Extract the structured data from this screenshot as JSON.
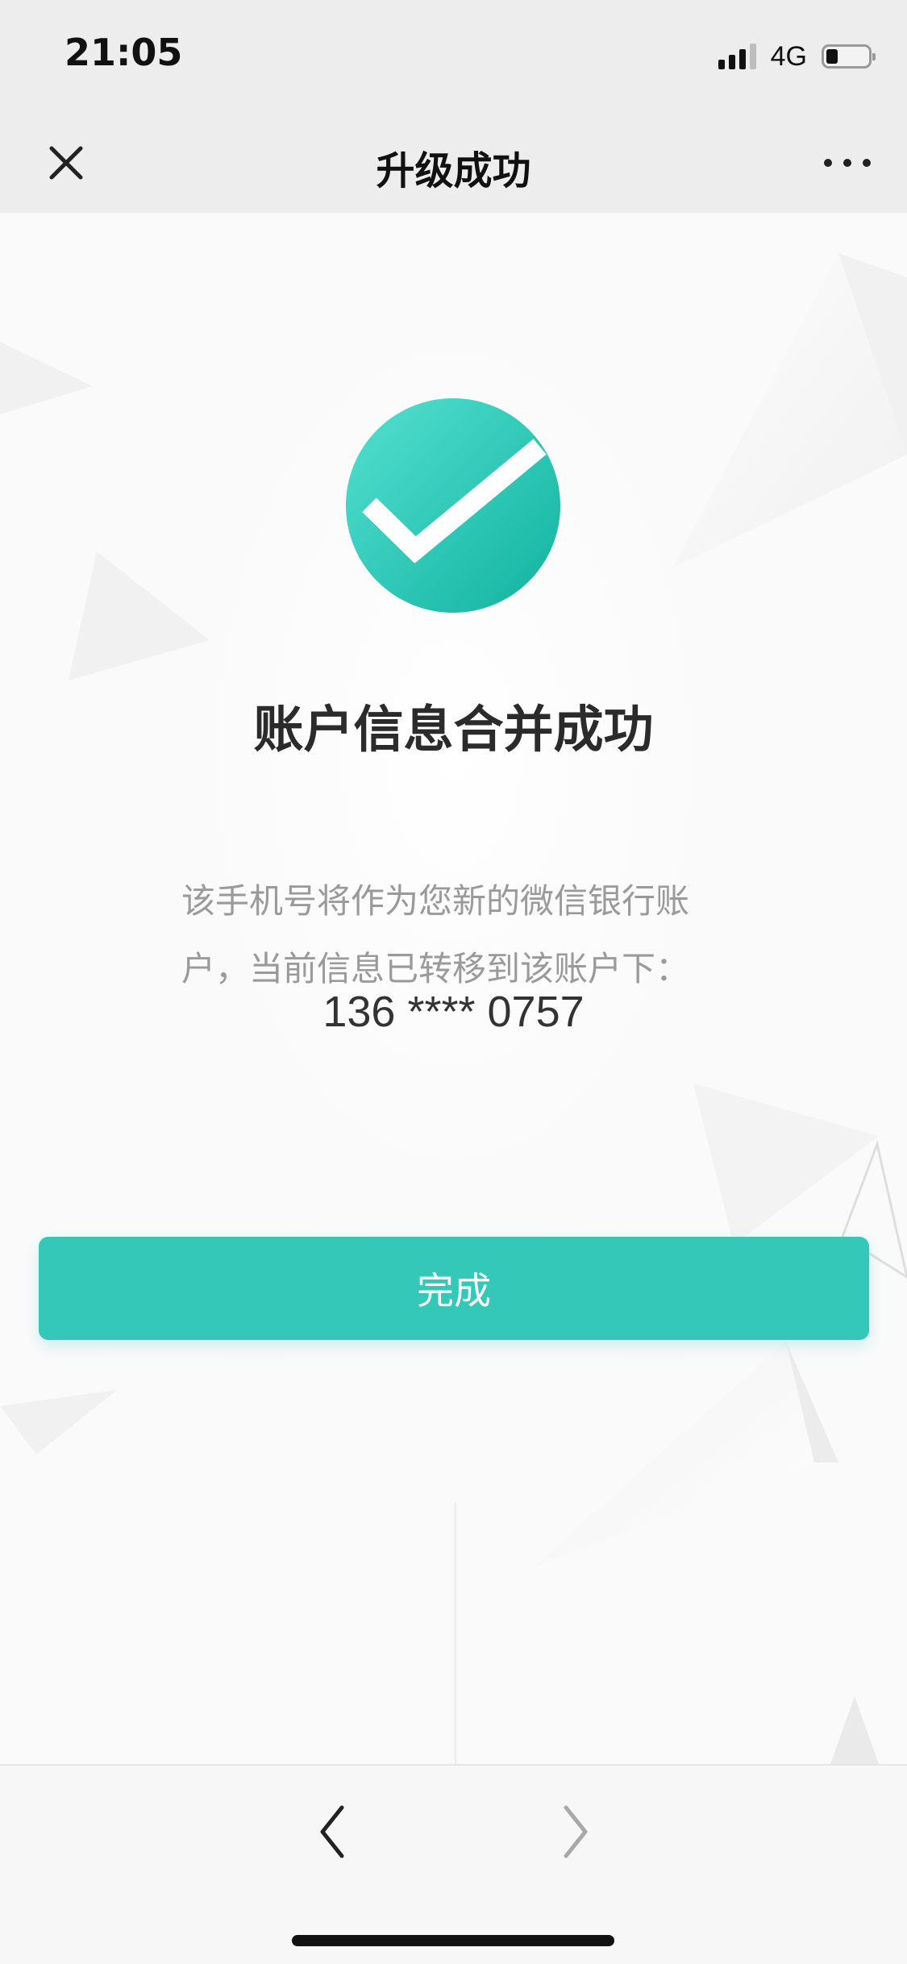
{
  "status_bar": {
    "time": "21:05",
    "network": "4G",
    "signal_icon": "signal-strength-icon",
    "battery_icon": "battery-icon"
  },
  "nav_bar": {
    "title": "升级成功",
    "close_icon": "close-icon",
    "more_icon": "more-icon"
  },
  "result": {
    "icon": "success-check-icon",
    "title": "账户信息合并成功",
    "description_line_1": "该手机号将作为您新的微信银行账",
    "description_line_2": "户，当前信息已转移到该账户下：",
    "phone_number": "136 **** 0757"
  },
  "actions": {
    "done_label": "完成"
  },
  "bottom_bar": {
    "back_icon": "back-arrow-icon",
    "forward_icon": "forward-arrow-icon"
  },
  "colors": {
    "accent": "#33c8b7",
    "status_background": "#ededed",
    "title_text": "#2b2b2b",
    "secondary_text": "#9a9a9a"
  }
}
